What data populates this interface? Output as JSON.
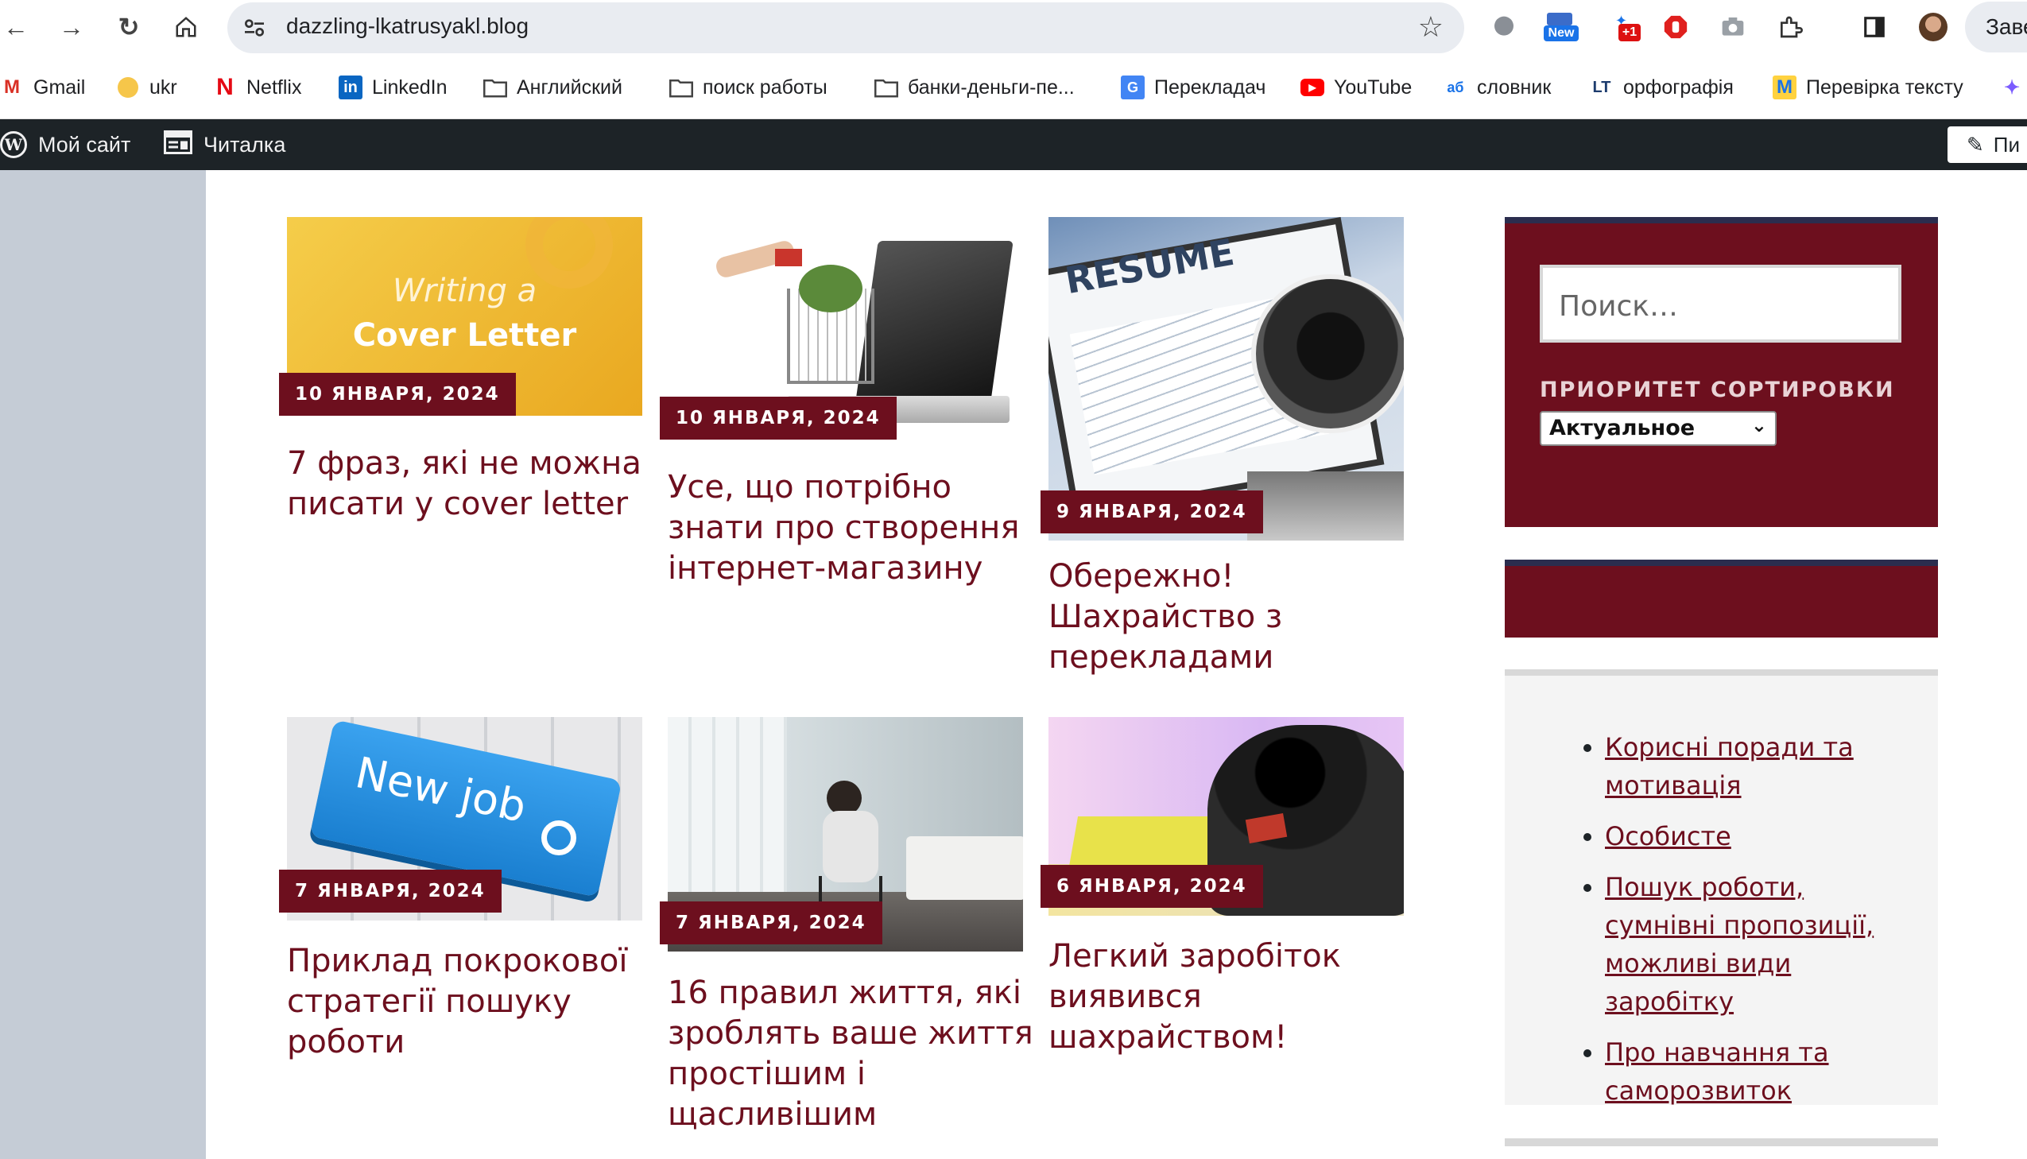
{
  "browser": {
    "url": "dazzling-lkatrusyakl.blog",
    "profile_label": "Заве",
    "new_badge": "New",
    "plus_badge": "+1"
  },
  "bookmarks": [
    {
      "label": "Gmail",
      "icon": "gmail-icon"
    },
    {
      "label": "ukr",
      "icon": "ukr-icon"
    },
    {
      "label": "Netflix",
      "icon": "netflix-icon"
    },
    {
      "label": "LinkedIn",
      "icon": "linkedin-icon"
    },
    {
      "label": "Английский",
      "icon": "folder-icon"
    },
    {
      "label": "поиск работы",
      "icon": "folder-icon"
    },
    {
      "label": "банки-деньги-пе...",
      "icon": "folder-icon"
    },
    {
      "label": "Перекладач",
      "icon": "translate-icon"
    },
    {
      "label": "YouTube",
      "icon": "youtube-icon"
    },
    {
      "label": "словник",
      "icon": "dictionary-icon"
    },
    {
      "label": "орфографія",
      "icon": "languagetool-icon"
    },
    {
      "label": "Перевірка тексту",
      "icon": "text-check-icon"
    }
  ],
  "adminbar": {
    "my_site": "Мой сайт",
    "reader": "Читалка",
    "write": "Пи"
  },
  "posts": [
    {
      "date": "10 ЯНВАРЯ, 2024",
      "title": "7 фраз, які не можна писати у cover letter",
      "image_text_1": "Writing a",
      "image_text_2": "Cover Letter"
    },
    {
      "date": "10 ЯНВАРЯ, 2024",
      "title": "Усе, що потрібно знати про створення інтернет-магазину"
    },
    {
      "date": "9 ЯНВАРЯ, 2024",
      "title": "Обережно! Шахрайство з перекладами",
      "image_text_1": "RESUME"
    },
    {
      "date": "7 ЯНВАРЯ, 2024",
      "title": "Приклад покрокової стратегії пошуку роботи",
      "image_text_1": "New job"
    },
    {
      "date": "7 ЯНВАРЯ, 2024",
      "title": "16 правил життя, які зроблять ваше життя простішим і щасливішим"
    },
    {
      "date": "6 ЯНВАРЯ, 2024",
      "title": "Легкий заробіток виявився шахрайством!"
    }
  ],
  "sidebar": {
    "search_placeholder": "Поиск…",
    "sort_label": "ПРИОРИТЕТ СОРТИРОВКИ",
    "sort_value": "Актуальное",
    "categories": [
      "Корисні поради та мотивація",
      "Особисте",
      "Пошук роботи, сумнівні пропозиції, можливі види заробітку",
      "Про навчання та саморозвиток"
    ]
  },
  "colors": {
    "accent": "#6d0f1e",
    "widget_border": "#2b2d4e",
    "admin_bar": "#1d2327"
  }
}
